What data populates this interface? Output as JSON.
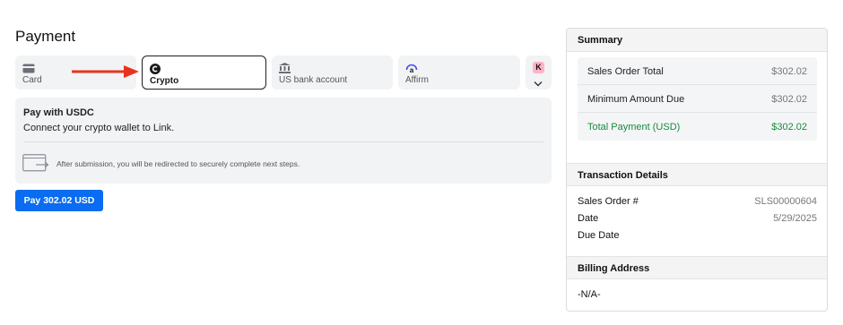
{
  "page": {
    "title": "Payment"
  },
  "tabs": [
    {
      "label": "Card",
      "icon": "card-icon"
    },
    {
      "label": "Crypto",
      "icon": "crypto-icon",
      "active": true
    },
    {
      "label": "US bank account",
      "icon": "bank-icon"
    },
    {
      "label": "Affirm",
      "icon": "affirm-icon"
    },
    {
      "badge": "K",
      "icon": "chevron-down-icon"
    }
  ],
  "crypto_info": {
    "title": "Pay with USDC",
    "subtitle": "Connect your crypto wallet to Link.",
    "redirect_note": "After submission, you will be redirected to securely complete next steps."
  },
  "pay_button": {
    "label": "Pay 302.02 USD"
  },
  "summary": {
    "header": "Summary",
    "rows": [
      {
        "label": "Sales Order Total",
        "value": "$302.02"
      },
      {
        "label": "Minimum Amount Due",
        "value": "$302.02"
      },
      {
        "label": "Total Payment (USD)",
        "value": "$302.02"
      }
    ]
  },
  "transaction": {
    "header": "Transaction Details",
    "rows": [
      {
        "label": "Sales Order #",
        "value": "SLS00000604"
      },
      {
        "label": "Date",
        "value": "5/29/2025"
      },
      {
        "label": "Due Date",
        "value": ""
      }
    ]
  },
  "billing": {
    "header": "Billing Address",
    "value": "-N/A-"
  },
  "colors": {
    "accent": "#0a6cf0",
    "total_green": "#1a8a3c",
    "annotation_red": "#e8331c"
  }
}
